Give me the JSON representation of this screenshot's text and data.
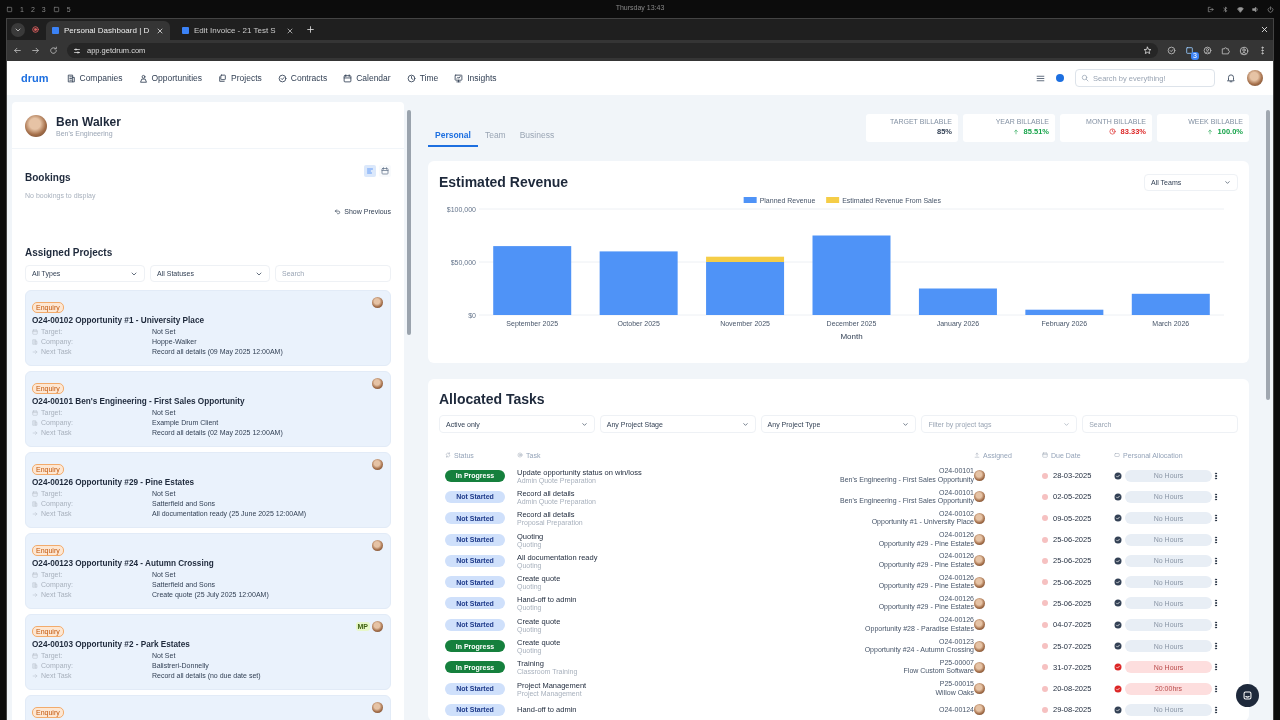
{
  "desktop": {
    "workspaces": [
      {
        "kind": "icon"
      },
      {
        "kind": "number",
        "label": "1"
      },
      {
        "kind": "number",
        "label": "2"
      },
      {
        "kind": "number",
        "label": "3"
      },
      {
        "kind": "icon"
      },
      {
        "kind": "number",
        "label": "5"
      }
    ],
    "clock": "Thursday 13:43"
  },
  "browser": {
    "tabs": [
      {
        "title": "Personal Dashboard | D",
        "selected": true
      },
      {
        "title": "Edit Invoice - 21 Test S",
        "selected": false
      }
    ],
    "url": "app.getdrum.com",
    "extension_badge": "3"
  },
  "app_nav": {
    "logo": "drum",
    "items": [
      {
        "label": "Companies"
      },
      {
        "label": "Opportunities"
      },
      {
        "label": "Projects"
      },
      {
        "label": "Contracts"
      },
      {
        "label": "Calendar"
      },
      {
        "label": "Time"
      },
      {
        "label": "Insights"
      }
    ],
    "search_placeholder": "Search by everything!"
  },
  "profile": {
    "name": "Ben Walker",
    "company": "Ben's Engineering"
  },
  "bookings": {
    "title": "Bookings",
    "empty_text": "No bookings to display",
    "view_toggle": [
      {
        "selected": true
      },
      {
        "selected": false
      }
    ],
    "show_previous": "Show Previous"
  },
  "assigned_projects": {
    "title": "Assigned Projects",
    "filters": [
      {
        "value": "All Types"
      },
      {
        "value": "All Statuses"
      }
    ],
    "search_placeholder": "Search",
    "cards": [
      {
        "badge": "Enquiry",
        "title": "O24-00102 Opportunity #1 - University Place",
        "fields": [
          {
            "label": "Target:",
            "value": "Not Set"
          },
          {
            "label": "Company:",
            "value": "Hoppe-Walker"
          },
          {
            "label": "Next Task",
            "value": "Record all details (09 May 2025 12:00AM)"
          }
        ]
      },
      {
        "badge": "Enquiry",
        "title": "O24-00101 Ben's Engineering - First Sales Opportunity",
        "fields": [
          {
            "label": "Target:",
            "value": "Not Set"
          },
          {
            "label": "Company:",
            "value": "Example Drum Client"
          },
          {
            "label": "Next Task",
            "value": "Record all details (02 May 2025 12:00AM)"
          }
        ]
      },
      {
        "badge": "Enquiry",
        "title": "O24-00126 Opportunity #29 - Pine Estates",
        "fields": [
          {
            "label": "Target:",
            "value": "Not Set"
          },
          {
            "label": "Company:",
            "value": "Satterfield and Sons"
          },
          {
            "label": "Next Task",
            "value": "All documentation ready (25 June 2025 12:00AM)"
          }
        ]
      },
      {
        "badge": "Enquiry",
        "title": "O24-00123 Opportunity #24 - Autumn Crossing",
        "fields": [
          {
            "label": "Target:",
            "value": "Not Set"
          },
          {
            "label": "Company:",
            "value": "Satterfield and Sons"
          },
          {
            "label": "Next Task",
            "value": "Create quote (25 July 2025 12:00AM)"
          }
        ]
      },
      {
        "badge": "Enquiry",
        "title": "O24-00103 Opportunity #2 - Park Estates",
        "extra_assignee": "MP",
        "fields": [
          {
            "label": "Target:",
            "value": "Not Set"
          },
          {
            "label": "Company:",
            "value": "Balistreri-Donnelly"
          },
          {
            "label": "Next Task",
            "value": "Record all details (no due date set)"
          }
        ]
      },
      {
        "badge": "Enquiry"
      }
    ]
  },
  "dashboard_tabs": [
    {
      "label": "Personal",
      "selected": true
    },
    {
      "label": "Team",
      "selected": false
    },
    {
      "label": "Business",
      "selected": false
    }
  ],
  "stats": [
    {
      "label": "TARGET BILLABLE",
      "value": "85%",
      "kind": "neutral"
    },
    {
      "label": "YEAR BILLABLE",
      "value": "85.51%",
      "kind": "up"
    },
    {
      "label": "MONTH BILLABLE",
      "value": "83.33%",
      "kind": "alert"
    },
    {
      "label": "WEEK BILLABLE",
      "value": "100.0%",
      "kind": "up"
    }
  ],
  "revenue": {
    "title": "Estimated Revenue",
    "team_filter": "All Teams",
    "chart_data": {
      "type": "bar",
      "stacked": true,
      "xlabel": "Month",
      "categories": [
        "September 2025",
        "October 2025",
        "November 2025",
        "December 2025",
        "January 2026",
        "February 2026",
        "March 2026"
      ],
      "series": [
        {
          "name": "Planned Revenue",
          "color": "#4f93f7",
          "values": [
            65000,
            60000,
            50000,
            75000,
            25000,
            5000,
            20000
          ]
        },
        {
          "name": "Estimated Revenue From Sales",
          "color": "#f5cd47",
          "values": [
            0,
            0,
            5000,
            0,
            0,
            0,
            0
          ]
        }
      ],
      "legend": "top",
      "ylim": [
        0,
        100000
      ],
      "yticks": [
        {
          "value": 0,
          "label": "$0"
        },
        {
          "value": 50000,
          "label": "$50,000"
        },
        {
          "value": 100000,
          "label": "$100,000"
        }
      ]
    }
  },
  "tasks": {
    "title": "Allocated Tasks",
    "filters": [
      {
        "kind": "select",
        "value": "Active only"
      },
      {
        "kind": "select",
        "value": "Any Project Stage"
      },
      {
        "kind": "select",
        "value": "Any Project Type"
      },
      {
        "kind": "select",
        "placeholder": "Filter by project tags"
      },
      {
        "kind": "text",
        "placeholder": "Search"
      }
    ],
    "columns": [
      "Status",
      "Task",
      "Assigned",
      "Due Date",
      "Personal Allocation"
    ],
    "rows": [
      {
        "status": "In Progress",
        "kind": "in_progress",
        "task": "Update opportunity status on win/loss",
        "stage": "Admin Quote Preparation",
        "project_code": "O24-00101",
        "project_name": "Ben's Engineering - First Sales Opportunity",
        "due": "28-03-2025",
        "allocation": "No Hours",
        "flagged": false
      },
      {
        "status": "Not Started",
        "kind": "not_started",
        "task": "Record all details",
        "stage": "Admin Quote Preparation",
        "project_code": "O24-00101",
        "project_name": "Ben's Engineering - First Sales Opportunity",
        "due": "02-05-2025",
        "allocation": "No Hours",
        "flagged": false
      },
      {
        "status": "Not Started",
        "kind": "not_started",
        "task": "Record all details",
        "stage": "Proposal Preparation",
        "project_code": "O24-00102",
        "project_name": "Opportunity #1 - University Place",
        "due": "09-05-2025",
        "allocation": "No Hours",
        "flagged": false
      },
      {
        "status": "Not Started",
        "kind": "not_started",
        "task": "Quoting",
        "stage": "Quoting",
        "project_code": "O24-00126",
        "project_name": "Opportunity #29 - Pine Estates",
        "due": "25-06-2025",
        "allocation": "No Hours",
        "flagged": false
      },
      {
        "status": "Not Started",
        "kind": "not_started",
        "task": "All documentation ready",
        "stage": "Quoting",
        "project_code": "O24-00126",
        "project_name": "Opportunity #29 - Pine Estates",
        "due": "25-06-2025",
        "allocation": "No Hours",
        "flagged": false
      },
      {
        "status": "Not Started",
        "kind": "not_started",
        "task": "Create quote",
        "stage": "Quoting",
        "project_code": "O24-00126",
        "project_name": "Opportunity #29 - Pine Estates",
        "due": "25-06-2025",
        "allocation": "No Hours",
        "flagged": false
      },
      {
        "status": "Not Started",
        "kind": "not_started",
        "task": "Hand-off to admin",
        "stage": "Quoting",
        "project_code": "O24-00126",
        "project_name": "Opportunity #29 - Pine Estates",
        "due": "25-06-2025",
        "allocation": "No Hours",
        "flagged": false
      },
      {
        "status": "Not Started",
        "kind": "not_started",
        "task": "Create quote",
        "stage": "Quoting",
        "project_code": "O24-00126",
        "project_name": "Opportunity #28 - Paradise Estates",
        "due": "04-07-2025",
        "allocation": "No Hours",
        "flagged": false
      },
      {
        "status": "In Progress",
        "kind": "in_progress",
        "task": "Create quote",
        "stage": "Quoting",
        "project_code": "O24-00123",
        "project_name": "Opportunity #24 - Autumn Crossing",
        "due": "25-07-2025",
        "allocation": "No Hours",
        "flagged": false
      },
      {
        "status": "In Progress",
        "kind": "in_progress",
        "task": "Training",
        "stage": "Classroom Training",
        "project_code": "P25-00007",
        "project_name": "Flow Custom Software",
        "due": "31-07-2025",
        "allocation": "No Hours",
        "flagged": true
      },
      {
        "status": "Not Started",
        "kind": "not_started",
        "task": "Project Management",
        "stage": "Project Management",
        "project_code": "P25-00015",
        "project_name": "Willow Oaks",
        "due": "20-08-2025",
        "allocation": "20:00hrs",
        "flagged": true
      },
      {
        "status": "Not Started",
        "kind": "not_started",
        "task": "Hand-off to admin",
        "project_code": "O24-00124",
        "due": "29-08-2025",
        "allocation": "No Hours",
        "flagged": false
      }
    ]
  }
}
